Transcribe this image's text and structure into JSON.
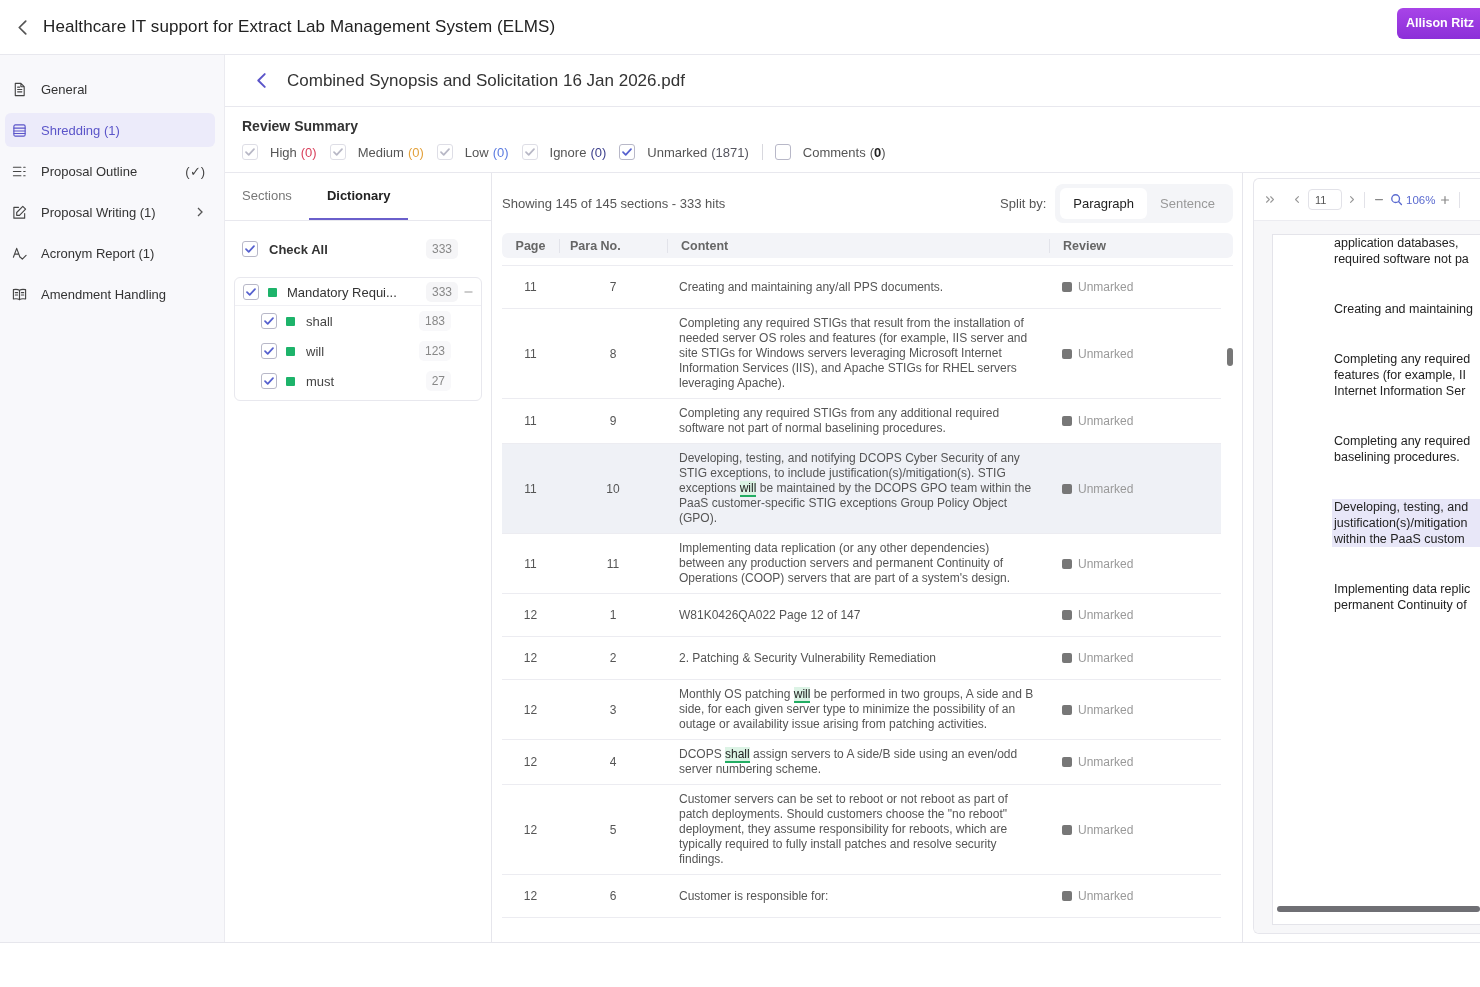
{
  "header": {
    "title": "Healthcare IT support for Extract Lab Management System (ELMS)",
    "user_button": "Allison Ritz"
  },
  "sidebar": {
    "items": [
      {
        "label": "General",
        "selected": false,
        "has_submenu": false
      },
      {
        "label": "Shredding (1)",
        "selected": true,
        "has_submenu": false
      },
      {
        "label": "Proposal Outline",
        "badge": "(✓)",
        "selected": false,
        "has_submenu": false
      },
      {
        "label": "Proposal Writing (1)",
        "selected": false,
        "has_submenu": true
      },
      {
        "label": "Acronym Report (1)",
        "selected": false,
        "has_submenu": false
      },
      {
        "label": "Amendment Handling",
        "selected": false,
        "has_submenu": false
      }
    ]
  },
  "document": {
    "title": "Combined Synopsis and Solicitation 16 Jan 2026.pdf"
  },
  "review_summary": {
    "title": "Review Summary",
    "filters": [
      {
        "label": "High",
        "count": "(0)",
        "color": "#d9415c",
        "checked": true,
        "disabled": true
      },
      {
        "label": "Medium",
        "count": "(0)",
        "color": "#e3a13b",
        "checked": true,
        "disabled": true
      },
      {
        "label": "Low",
        "count": "(0)",
        "color": "#5b7be0",
        "checked": true,
        "disabled": true
      },
      {
        "label": "Ignore",
        "count": "(0)",
        "color": "#3c3f8c",
        "checked": true,
        "disabled": true
      },
      {
        "label": "Unmarked",
        "count": "(1871)",
        "color": "#55555f",
        "checked": true,
        "disabled": false
      }
    ],
    "comments": {
      "label": "Comments",
      "count": "(**0**)",
      "checked": false
    }
  },
  "dictionary_panel": {
    "tabs": [
      {
        "label": "Sections",
        "selected": false
      },
      {
        "label": "Dictionary",
        "selected": true
      }
    ],
    "check_all": {
      "label": "Check All",
      "count": "333",
      "checked": true
    },
    "groups": [
      {
        "label": "Mandatory Requi...",
        "count": "333",
        "color": "#1db36a",
        "checked": true,
        "expanded": true,
        "children": [
          {
            "label": "shall",
            "count": "183",
            "color": "#1db36a",
            "checked": true
          },
          {
            "label": "will",
            "count": "123",
            "color": "#1db36a",
            "checked": true
          },
          {
            "label": "must",
            "count": "27",
            "color": "#1db36a",
            "checked": true
          }
        ]
      }
    ]
  },
  "sections_view": {
    "summary": "Showing 145 of 145 sections - 333 hits",
    "split_label": "Split by:",
    "split_options": [
      {
        "label": "Paragraph",
        "selected": true
      },
      {
        "label": "Sentence",
        "selected": false
      }
    ],
    "table": {
      "columns": [
        "Page",
        "Para No.",
        "Content",
        "Review"
      ],
      "rows": [
        {
          "page": "11",
          "para": "7",
          "selected": false,
          "review": "Unmarked",
          "content": [
            {
              "text": "Creating and maintaining any/all PPS documents.",
              "hit": false
            }
          ]
        },
        {
          "page": "11",
          "para": "8",
          "selected": false,
          "review": "Unmarked",
          "content": [
            {
              "text": "Completing any required STIGs that result from the installation of needed server OS roles and features (for example, IIS server and site STIGs for Windows servers leveraging Microsoft Internet Information Services (IIS), and Apache STIGs for RHEL servers leveraging Apache).",
              "hit": false
            }
          ]
        },
        {
          "page": "11",
          "para": "9",
          "selected": false,
          "review": "Unmarked",
          "content": [
            {
              "text": "Completing any required STIGs from any additional required software not part of normal baselining procedures.",
              "hit": false
            }
          ]
        },
        {
          "page": "11",
          "para": "10",
          "selected": true,
          "review": "Unmarked",
          "content": [
            {
              "text": "Developing, testing, and notifying DCOPS Cyber Security of any STIG exceptions, to include justification(s)/mitigation(s). STIG exceptions ",
              "hit": false
            },
            {
              "text": "will",
              "hit": true
            },
            {
              "text": " be maintained by the DCOPS GPO team within the PaaS customer-specific STIG exceptions Group Policy Object (GPO).",
              "hit": false
            }
          ]
        },
        {
          "page": "11",
          "para": "11",
          "selected": false,
          "review": "Unmarked",
          "content": [
            {
              "text": "Implementing data replication (or any other dependencies) between any production servers and permanent Continuity of Operations (COOP) servers that are part of a system's design.",
              "hit": false
            }
          ]
        },
        {
          "page": "12",
          "para": "1",
          "selected": false,
          "review": "Unmarked",
          "content": [
            {
              "text": "W81K0426QA022 Page 12 of 147",
              "hit": false
            }
          ]
        },
        {
          "page": "12",
          "para": "2",
          "selected": false,
          "review": "Unmarked",
          "content": [
            {
              "text": "2. Patching & Security Vulnerability Remediation",
              "hit": false
            }
          ]
        },
        {
          "page": "12",
          "para": "3",
          "selected": false,
          "review": "Unmarked",
          "content": [
            {
              "text": "Monthly OS patching ",
              "hit": false
            },
            {
              "text": "will",
              "hit": true
            },
            {
              "text": " be performed in two groups, A side and B side, for each given server type to minimize the possibility of an outage or availability issue arising from patching activities.",
              "hit": false
            }
          ]
        },
        {
          "page": "12",
          "para": "4",
          "selected": false,
          "review": "Unmarked",
          "content": [
            {
              "text": "DCOPS ",
              "hit": false
            },
            {
              "text": "shall",
              "hit": true
            },
            {
              "text": " assign servers to A side/B side using an even/odd server numbering scheme.",
              "hit": false
            }
          ]
        },
        {
          "page": "12",
          "para": "5",
          "selected": false,
          "review": "Unmarked",
          "content": [
            {
              "text": "Customer servers can be set to reboot or not reboot as part of patch deployments. Should customers choose the \"no reboot\" deployment, they assume responsibility for reboots, which are typically required to fully install patches and resolve security findings.",
              "hit": false
            }
          ]
        },
        {
          "page": "12",
          "para": "6",
          "selected": false,
          "review": "Unmarked",
          "content": [
            {
              "text": "Customer is responsible for:",
              "hit": false
            }
          ]
        }
      ]
    }
  },
  "pdf_viewer": {
    "page_input": "11",
    "zoom": "106%",
    "paragraphs": [
      {
        "lines": [
          "application databases,",
          "required software not pa"
        ],
        "highlighted": false
      },
      {
        "lines": [
          "Creating and maintaining"
        ],
        "highlighted": false
      },
      {
        "lines": [
          "Completing any required",
          "features (for example, II",
          "Internet Information Ser"
        ],
        "highlighted": false
      },
      {
        "lines": [
          "Completing any required",
          "baselining procedures."
        ],
        "highlighted": false
      },
      {
        "lines": [
          "Developing, testing, and",
          "justification(s)/mitigation",
          "within the PaaS custom"
        ],
        "highlighted": true
      },
      {
        "lines": [
          "Implementing data replic",
          "permanent Continuity of"
        ],
        "highlighted": false
      }
    ]
  }
}
